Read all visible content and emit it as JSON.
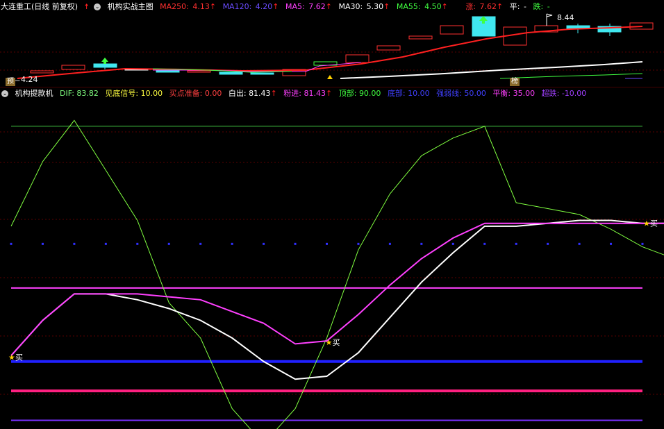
{
  "header": {
    "stock_title": "大连重工(日线 前复权)",
    "main_indicator": "机构实战主图",
    "ma250": {
      "label": "MA250:",
      "value": "4.13",
      "color": "#ff3030"
    },
    "ma120": {
      "label": "MA120:",
      "value": "4.20",
      "color": "#6a4cff"
    },
    "ma5": {
      "label": "MA5:",
      "value": "7.62",
      "color": "#ff40ff"
    },
    "ma30": {
      "label": "MA30:",
      "value": "5.30",
      "color": "#ffffff"
    },
    "ma55": {
      "label": "MA55:",
      "value": "4.50",
      "color": "#40ff40"
    },
    "rise": {
      "label": "涨:",
      "value": "7.62"
    },
    "flat": {
      "label": "平:",
      "value": "-"
    },
    "fall": {
      "label": "跌:",
      "value": "-"
    }
  },
  "main_chart": {
    "high_label": "8.44",
    "low_label": "4.24",
    "tag_left": "预",
    "tag_right": "榜"
  },
  "indicator": {
    "name": "机构提款机",
    "dif": {
      "label": "DIF:",
      "value": "83.82",
      "color": "#80ff80"
    },
    "bottom_signal": {
      "label": "见底信号:",
      "value": "10.00",
      "color": "#ffff40"
    },
    "buy_prep": {
      "label": "买点准备:",
      "value": "0.00",
      "color": "#ff4040"
    },
    "white_out": {
      "label": "白出:",
      "value": "81.43",
      "color": "#ffffff"
    },
    "pink_in": {
      "label": "粉进:",
      "value": "81.43",
      "color": "#ff40ff"
    },
    "top": {
      "label": "顶部:",
      "value": "90.00",
      "color": "#40ff40"
    },
    "bottom": {
      "label": "底部:",
      "value": "10.00",
      "color": "#4040ff"
    },
    "strength": {
      "label": "强弱线:",
      "value": "50.00",
      "color": "#4040ff"
    },
    "balance": {
      "label": "平衡:",
      "value": "35.00",
      "color": "#ff40ff"
    },
    "over_fall": {
      "label": "超跌:",
      "value": "-10.00",
      "color": "#a040ff"
    },
    "buy_label": "买"
  },
  "chart_data": {
    "type": "line",
    "series": [
      {
        "name": "DIF",
        "values": [
          56,
          78,
          92,
          75,
          58,
          30,
          18,
          -6,
          -18,
          -6,
          18,
          48,
          67,
          80,
          86,
          90,
          64,
          62,
          60,
          55,
          49,
          45,
          53
        ]
      },
      {
        "name": "白出",
        "values": [
          12,
          24,
          33,
          33,
          31,
          28,
          24,
          18,
          10,
          4,
          5,
          13,
          25,
          37,
          47,
          56,
          56,
          57,
          58,
          58,
          57,
          57,
          56
        ]
      },
      {
        "name": "粉进",
        "values": [
          12,
          24,
          33,
          33,
          33,
          32,
          31,
          27,
          23,
          16,
          17,
          26,
          36,
          45,
          52,
          57,
          57,
          57,
          57,
          57,
          57,
          57,
          57
        ]
      }
    ],
    "ylim": [
      -12,
      98
    ]
  }
}
